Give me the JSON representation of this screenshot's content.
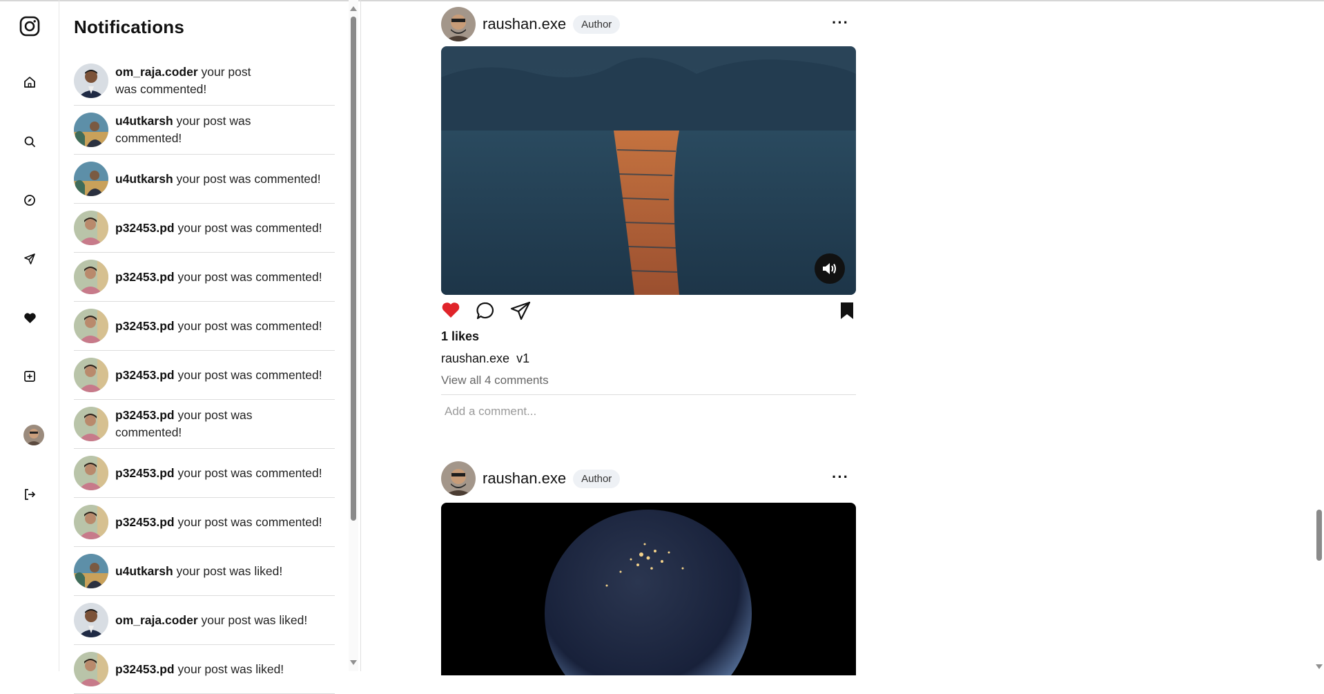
{
  "app": {
    "logo_name": "instagram-logo"
  },
  "rail": {
    "items": [
      {
        "name": "home-icon"
      },
      {
        "name": "search-icon"
      },
      {
        "name": "explore-icon"
      },
      {
        "name": "send-icon"
      },
      {
        "name": "heart-icon"
      },
      {
        "name": "create-icon"
      },
      {
        "name": "profile-avatar"
      },
      {
        "name": "logout-icon"
      }
    ]
  },
  "notifications": {
    "title": "Notifications",
    "items": [
      {
        "user": "om_raja.coder",
        "text": "your post was commented!"
      },
      {
        "user": "u4utkarsh",
        "text": "your post was commented!"
      },
      {
        "user": "u4utkarsh",
        "text": "your post was commented!"
      },
      {
        "user": "p32453.pd",
        "text": "your post was commented!"
      },
      {
        "user": "p32453.pd",
        "text": "your post was commented!"
      },
      {
        "user": "p32453.pd",
        "text": "your post was commented!"
      },
      {
        "user": "p32453.pd",
        "text": "your post was commented!"
      },
      {
        "user": "p32453.pd",
        "text": "your post was commented!"
      },
      {
        "user": "p32453.pd",
        "text": "your post was commented!"
      },
      {
        "user": "p32453.pd",
        "text": "your post was commented!"
      },
      {
        "user": "u4utkarsh",
        "text": "your post was liked!"
      },
      {
        "user": "om_raja.coder",
        "text": "your post was liked!"
      },
      {
        "user": "p32453.pd",
        "text": "your post was liked!"
      }
    ]
  },
  "posts": [
    {
      "username": "raushan.exe",
      "badge": "Author",
      "likes": "1 likes",
      "caption_user": "raushan.exe",
      "caption_text": "v1",
      "view_all": "View all 4 comments",
      "comment_placeholder": "Add a comment..."
    },
    {
      "username": "raushan.exe",
      "badge": "Author"
    }
  ],
  "colors": {
    "like_red": "#e0242a",
    "badge_bg": "#eef1f5"
  }
}
